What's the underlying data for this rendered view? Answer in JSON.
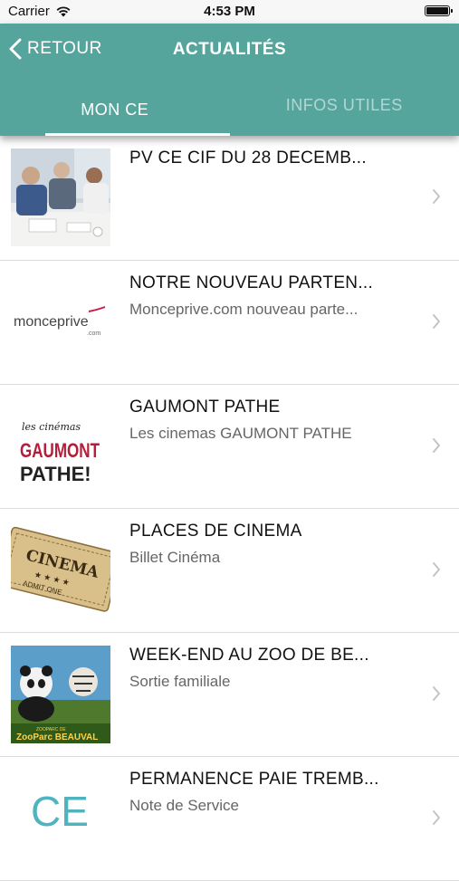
{
  "status_bar": {
    "carrier": "Carrier",
    "time": "4:53 PM"
  },
  "header": {
    "back_label": "RETOUR",
    "title": "ACTUALITÉS"
  },
  "tabs": [
    {
      "label": "MON CE",
      "active": true
    },
    {
      "label": "INFOS UTILES",
      "active": false
    }
  ],
  "accent_color": "#56a59c",
  "items": [
    {
      "title": "PV CE CIF DU 28 DECEMB...",
      "subtitle": "",
      "thumbnail": "business-meeting-photo"
    },
    {
      "title": "NOTRE NOUVEAU PARTEN...",
      "subtitle": "Monceprive.com nouveau parte...",
      "thumbnail": "monceprive-logo",
      "logo_text": "monceprive",
      "logo_sub": ".com"
    },
    {
      "title": "GAUMONT PATHE",
      "subtitle": "Les cinemas GAUMONT PATHE",
      "thumbnail": "gaumont-pathe-logo",
      "logo_line1": "les cinémas",
      "logo_line2": "GAUMONT",
      "logo_line3": "PATHE!"
    },
    {
      "title": "PLACES DE CINEMA",
      "subtitle": "Billet Cinéma",
      "thumbnail": "cinema-ticket-image",
      "ticket_text": "CINEMA",
      "ticket_sub": "ADMIT ONE"
    },
    {
      "title": "WEEK-END AU ZOO DE BE...",
      "subtitle": "Sortie familiale",
      "thumbnail": "zooparc-beauval-image",
      "zoo_small": "ZOOPARC DE",
      "zoo_text": "ZooParc BEAUVAL"
    },
    {
      "title": "PERMANENCE PAIE TREMB...",
      "subtitle": "Note de Service",
      "thumbnail": "ce-logo",
      "logo_text": "CE"
    }
  ]
}
